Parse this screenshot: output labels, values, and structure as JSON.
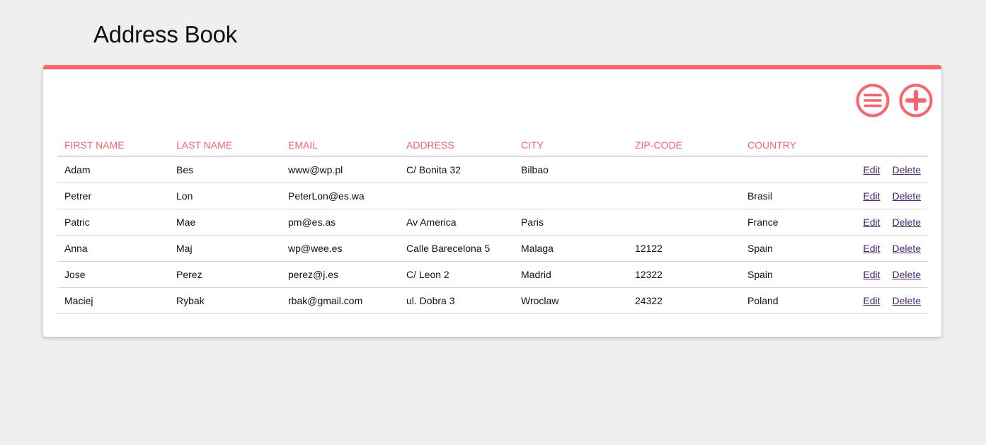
{
  "app": {
    "title": "Address Book"
  },
  "colors": {
    "accent": "#fc636b",
    "link": "#4b2a7a",
    "background": "#efefef"
  },
  "toolbar": {
    "list_icon": "list-icon",
    "add_icon": "add-icon"
  },
  "table": {
    "headers": [
      "FIRST NAME",
      "LAST NAME",
      "EMAIL",
      "ADDRESS",
      "CITY",
      "ZIP-CODE",
      "COUNTRY"
    ],
    "edit_label": "Edit",
    "delete_label": "Delete",
    "rows": [
      [
        "Adam",
        "Bes",
        "www@wp.pl",
        "C/ Bonita 32",
        "Bilbao",
        "",
        ""
      ],
      [
        "Petrer",
        "Lon",
        "PeterLon@es.wa",
        "",
        "",
        "",
        "Brasil"
      ],
      [
        "Patric",
        "Mae",
        "pm@es.as",
        "Av America",
        "Paris",
        "",
        "France"
      ],
      [
        "Anna",
        "Maj",
        "wp@wee.es",
        "Calle Barecelona 5",
        "Malaga",
        "12122",
        "Spain"
      ],
      [
        "Jose",
        "Perez",
        "perez@j.es",
        "C/ Leon 2",
        "Madrid",
        "12322",
        "Spain"
      ],
      [
        "Maciej",
        "Rybak",
        "rbak@gmail.com",
        "ul. Dobra 3",
        "Wroclaw",
        "24322",
        "Poland"
      ]
    ]
  }
}
